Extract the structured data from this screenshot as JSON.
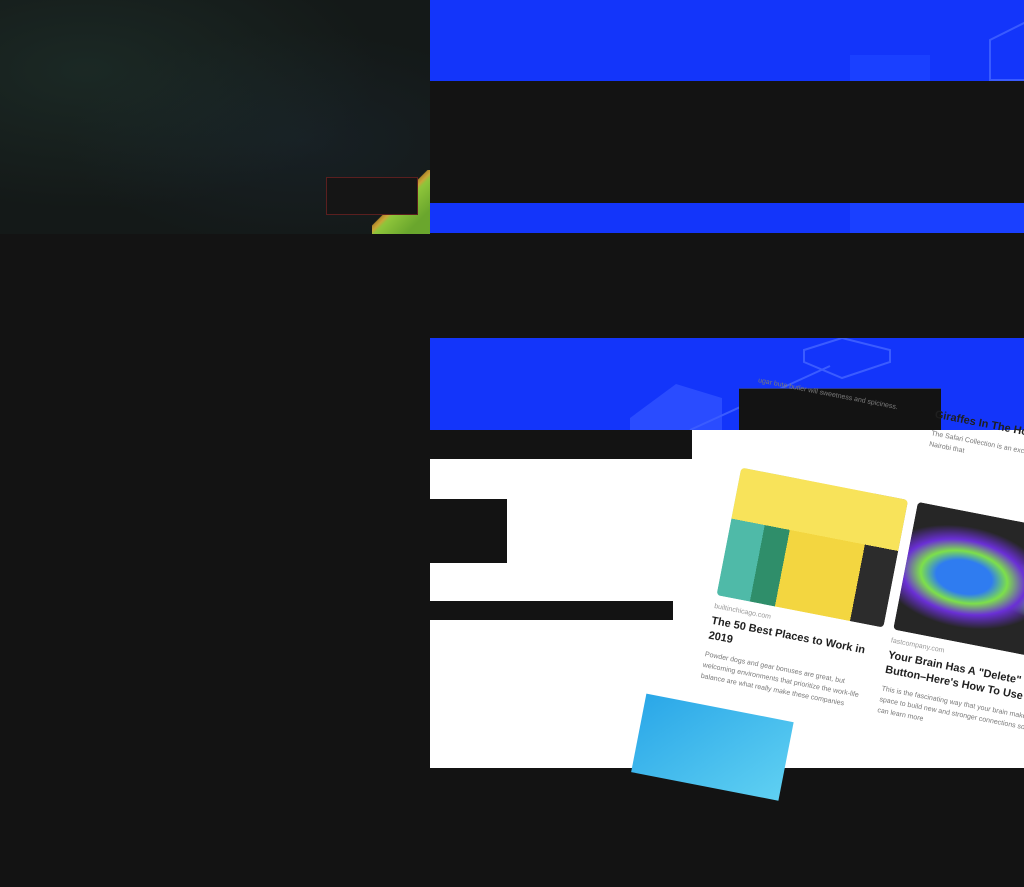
{
  "articles": [
    {
      "source": "",
      "title": "",
      "description": "ugar bute butler will sweetness and spiciness."
    },
    {
      "source": "",
      "title": "Giraffes In The Hotel",
      "description": "The Safari Collection is an exclusive boutique outside Nairobi that"
    },
    {
      "source": "builtinchicago.com",
      "title": "The 50 Best Places to Work in 2019",
      "description": "Powder dogs and gear bonuses are great, but welcoming environments that prioritize the work-life balance are what really make these companies"
    },
    {
      "source": "fastcompany.com",
      "title": "Your Brain Has A \"Delete\" Button–Here's How To Use It",
      "description": "This is the fascinating way that your brain makes space to build new and stronger connections so you can learn more"
    }
  ],
  "colors": {
    "accent_blue": "#1335fa",
    "dark_bg": "#131313",
    "content_bg": "#ffffff"
  }
}
